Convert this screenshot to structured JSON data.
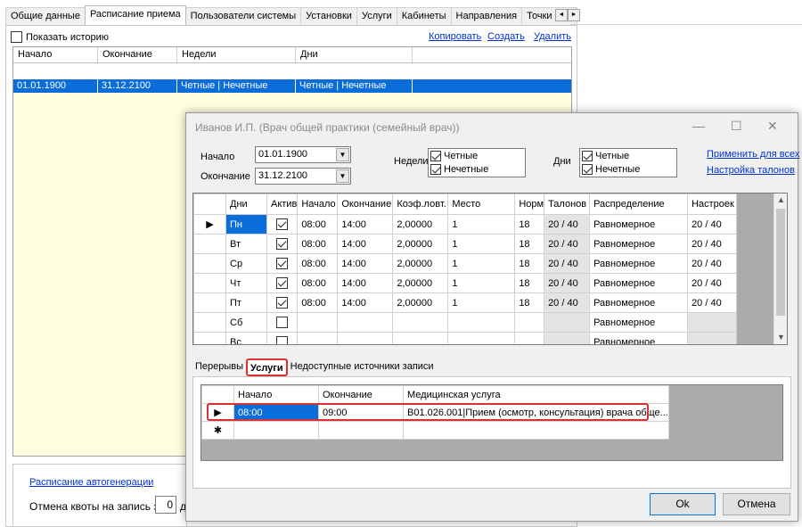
{
  "top_tabs": [
    "Общие данные",
    "Расписание приема",
    "Пользователи системы",
    "Установки",
    "Услуги",
    "Кабинеты",
    "Направления",
    "Точки обм"
  ],
  "top_tab_active_index": 1,
  "tab_scroll": {
    "left": "◄",
    "right": "►"
  },
  "show_history_label": "Показать историю",
  "actions": {
    "copy": "Копировать",
    "create": "Создать",
    "delete": "Удалить"
  },
  "main_grid": {
    "headers": [
      "Начало",
      "Окончание",
      "Недели",
      "Дни"
    ],
    "rows": [
      [
        "01.01.1900",
        "31.12.2100",
        "Четные | Нечетные",
        "Четные | Нечетные"
      ]
    ]
  },
  "autogen_link": "Расписание автогенерации",
  "quota_label": "Отмена квоты на запись за",
  "quota_value": "0",
  "quota_suffix": "д",
  "dialog": {
    "title": "Иванов И.П. (Врач общей практики (семейный врач))",
    "controls": {
      "minimize": "—",
      "maximize": "☐",
      "close": "✕"
    },
    "start_label": "Начало",
    "start_value": "01.01.1900",
    "end_label": "Окончание",
    "end_value": "31.12.2100",
    "weeks_label": "Недели",
    "weeks": [
      "Четные",
      "Нечетные"
    ],
    "days_label": "Дни",
    "days": [
      "Четные",
      "Нечетные"
    ],
    "apply_all_link": "Применить для всех",
    "tickets_link": "Настройка талонов",
    "schedule": {
      "headers": [
        "Дни",
        "Актив",
        "Начало",
        "Окончание",
        "Коэф.ловт.",
        "Место",
        "Норм",
        "Талонов",
        "Распределение",
        "Настроек"
      ],
      "rows": [
        {
          "day": "Пн",
          "active": true,
          "start": "08:00",
          "end": "14:00",
          "coef": "2,00000",
          "place": "1",
          "norm": "18",
          "tickets": "20 / 40",
          "distribution": "Равномерное",
          "settings": "20 / 40",
          "current": true
        },
        {
          "day": "Вт",
          "active": true,
          "start": "08:00",
          "end": "14:00",
          "coef": "2,00000",
          "place": "1",
          "norm": "18",
          "tickets": "20 / 40",
          "distribution": "Равномерное",
          "settings": "20 / 40"
        },
        {
          "day": "Ср",
          "active": true,
          "start": "08:00",
          "end": "14:00",
          "coef": "2,00000",
          "place": "1",
          "norm": "18",
          "tickets": "20 / 40",
          "distribution": "Равномерное",
          "settings": "20 / 40"
        },
        {
          "day": "Чт",
          "active": true,
          "start": "08:00",
          "end": "14:00",
          "coef": "2,00000",
          "place": "1",
          "norm": "18",
          "tickets": "20 / 40",
          "distribution": "Равномерное",
          "settings": "20 / 40"
        },
        {
          "day": "Пт",
          "active": true,
          "start": "08:00",
          "end": "14:00",
          "coef": "2,00000",
          "place": "1",
          "norm": "18",
          "tickets": "20 / 40",
          "distribution": "Равномерное",
          "settings": "20 / 40"
        },
        {
          "day": "Сб",
          "active": false,
          "start": "",
          "end": "",
          "coef": "",
          "place": "",
          "norm": "",
          "tickets": "",
          "distribution": "Равномерное",
          "settings": ""
        },
        {
          "day": "Вс",
          "active": false,
          "start": "",
          "end": "",
          "coef": "",
          "place": "",
          "norm": "",
          "tickets": "",
          "distribution": "Равномерное",
          "settings": ""
        }
      ]
    },
    "subtabs": [
      "Перерывы",
      "Услуги",
      "Недоступные источники записи"
    ],
    "subtab_active_index": 1,
    "services": {
      "headers": [
        "Начало",
        "Окончание",
        "Медицинская услуга"
      ],
      "rows": [
        {
          "start": "08:00",
          "end": "09:00",
          "service": "B01.026.001|Прием (осмотр, консультация) врача обще..."
        }
      ],
      "new_row_marker": "✱"
    },
    "ok_label": "Ok",
    "cancel_label": "Отмена"
  },
  "colors": {
    "selection": "#0a6dd9",
    "highlight": "#d93030",
    "link": "#0033cc"
  }
}
